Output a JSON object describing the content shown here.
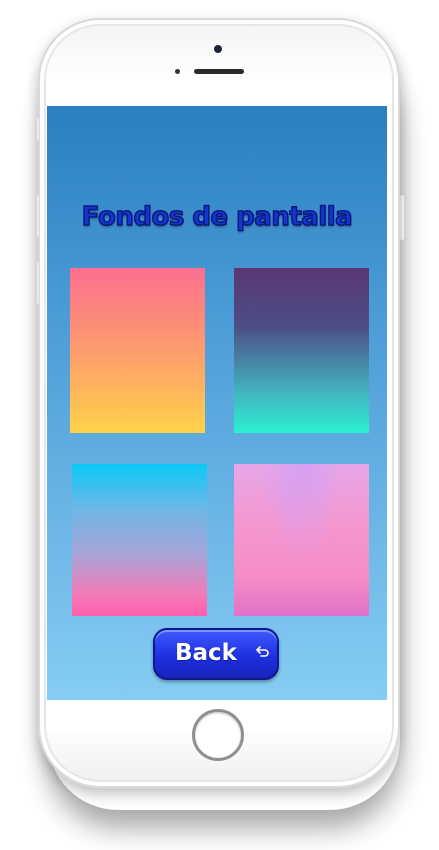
{
  "screen": {
    "title": "Fondos de pantalla",
    "wallpapers": [
      {
        "name": "wallpaper-pink-orange-yellow",
        "colors": [
          "#fb6f8f",
          "#ffd249"
        ]
      },
      {
        "name": "wallpaper-purple-teal",
        "colors": [
          "#5a3774",
          "#2cf0d0"
        ]
      },
      {
        "name": "wallpaper-cyan-pink",
        "colors": [
          "#0bcaf8",
          "#ff5fae"
        ]
      },
      {
        "name": "wallpaper-pink-lilac",
        "colors": [
          "#e7a6e8",
          "#e171c9"
        ]
      }
    ],
    "back_button": {
      "label": "Back",
      "icon": "undo-arrow-icon"
    }
  },
  "theme": {
    "screen_gradient": [
      "#2a7fc0",
      "#86cdf3"
    ],
    "title_color": "#1534d6",
    "button_color": "#1e2fe0"
  }
}
